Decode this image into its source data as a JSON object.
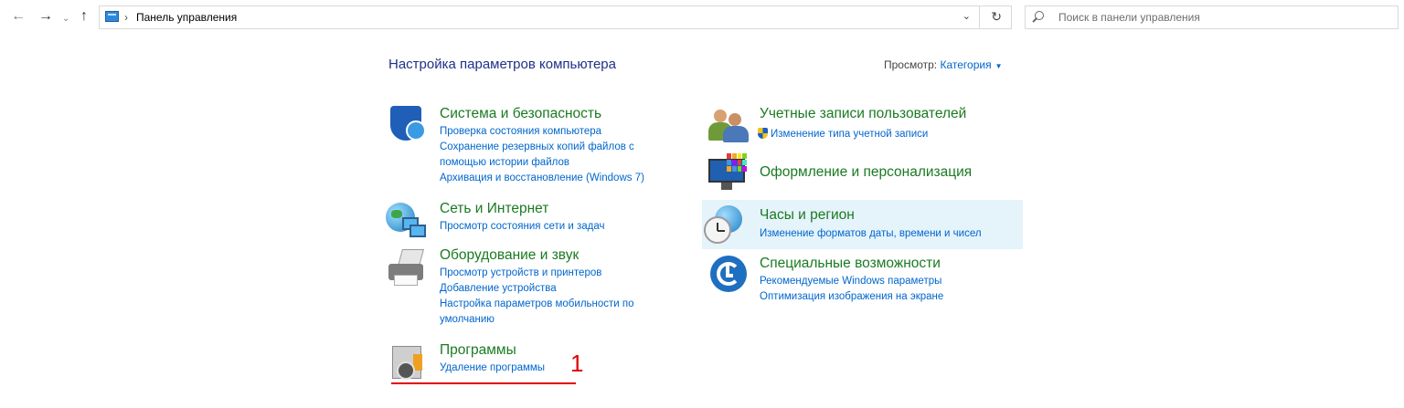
{
  "address_bar": {
    "path": "Панель управления",
    "search_placeholder": "Поиск в панели управления"
  },
  "header": {
    "title": "Настройка параметров компьютера",
    "view_by_label": "Просмотр:",
    "view_by_value": "Категория"
  },
  "categories": [
    {
      "title": "Система и безопасность",
      "icon": "shield-icon",
      "links": [
        "Проверка состояния компьютера",
        "Сохранение резервных копий файлов с",
        "помощью истории файлов",
        "Архивация и восстановление (Windows 7)"
      ]
    },
    {
      "title": "Сеть и Интернет",
      "icon": "network-globe-icon",
      "links": [
        "Просмотр состояния сети и задач"
      ]
    },
    {
      "title": "Оборудование и звук",
      "icon": "printer-icon",
      "links": [
        "Просмотр устройств и принтеров",
        "Добавление устройства",
        "Настройка параметров мобильности по",
        "умолчанию"
      ]
    },
    {
      "title": "Программы",
      "icon": "programs-icon",
      "links": [
        "Удаление программы"
      ]
    },
    {
      "title": "Учетные записи пользователей",
      "icon": "users-icon",
      "links": [
        "Изменение типа учетной записи"
      ]
    },
    {
      "title": "Оформление и персонализация",
      "icon": "appearance-icon",
      "links": []
    },
    {
      "title": "Часы и регион",
      "icon": "clock-region-icon",
      "links": [
        "Изменение форматов даты, времени и чисел"
      ]
    },
    {
      "title": "Специальные возможности",
      "icon": "accessibility-icon",
      "links": [
        "Рекомендуемые Windows параметры",
        "Оптимизация изображения на экране"
      ]
    }
  ],
  "annotation": {
    "number": "1",
    "color": "#e00000"
  },
  "colors": {
    "category_title": "#1a7a22",
    "link": "#0066cc",
    "header_title": "#1e3287",
    "hover_bg": "#e5f3fb"
  }
}
